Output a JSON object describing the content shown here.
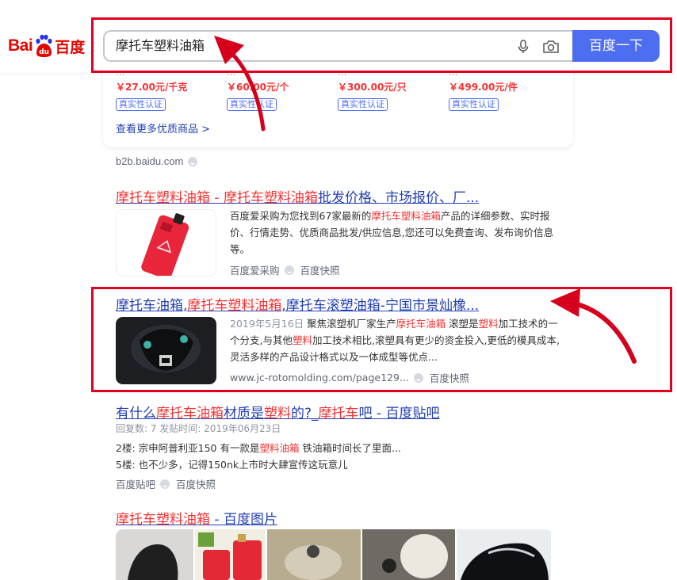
{
  "logo": {
    "latin": "Bai",
    "chinese": "百度"
  },
  "search": {
    "query": "摩托车塑料油箱",
    "button": "百度一下"
  },
  "products": [
    {
      "title": "...",
      "price": "￥27.00元/千克",
      "cert": "真实性认证"
    },
    {
      "title": "...",
      "price": "￥60.00元/个",
      "cert": "真实性认证"
    },
    {
      "title": "...",
      "price": "￥300.00元/只",
      "cert": "真实性认证"
    },
    {
      "title": "...",
      "price": "￥499.00元/件",
      "cert": "真实性认证"
    }
  ],
  "more_products": "查看更多优质商品 >",
  "source_domain": "b2b.baidu.com",
  "result1": {
    "title_a": "摩托车塑料油箱",
    "title_b": " - ",
    "title_c": "摩托车塑料油箱",
    "title_d": "批发价格、市场报价、厂...",
    "abstract_a": "百度爱采购为您找到67家最新的",
    "abstract_em": "摩托车塑料油箱",
    "abstract_b": "产品的详细参数、实时报价、行情走势、优质商品批发/供应信息,您还可以免费查询、发布询价信息等。",
    "source": "百度爱采购",
    "snapshot": "百度快照"
  },
  "result2": {
    "title_a": "摩托车油箱",
    "title_b": ",",
    "title_c": "摩托车塑料油箱",
    "title_d": ",摩托车滚塑油箱-宁国市景灿橡...",
    "date": "2019年5月16日",
    "abstract_a": " 聚焦滚塑机厂家生产",
    "abstract_em1": "摩托车油箱",
    "abstract_b": " 滚塑是",
    "abstract_em2": "塑料",
    "abstract_c": "加工技术的一个分支,与其他",
    "abstract_em3": "塑料",
    "abstract_d": "加工技术相比,滚塑具有更少的资金投入,更低的模具成本,灵活多样的产品设计格式以及一体成型等优点...",
    "url": "www.jc-rotomolding.com/page129...",
    "snapshot": "百度快照"
  },
  "result3": {
    "title_a": "有什么",
    "title_b": "摩托车油箱",
    "title_c": "材质是",
    "title_d": "塑料",
    "title_e": "的?_",
    "title_f": "摩托车",
    "title_g": "吧 - 百度贴吧",
    "meta": "回复数: 7 发贴时间: 2019年06月23日",
    "line1_a": "2楼: 宗申阿普利亚150 有一款是",
    "line1_em": "塑料油箱",
    "line1_b": " 铁油箱时间长了里面...",
    "line2": "5楼: 也不少多，记得150nk上市时大肆宣传这玩意儿",
    "source": "百度贴吧",
    "snapshot": "百度快照"
  },
  "result4": {
    "title_a": "摩托车塑料油箱",
    "title_b": " - 百度图片"
  },
  "colors": {
    "brand_red": "#e10601",
    "link_blue": "#2440b3",
    "highlight_red": "#f73131",
    "button_blue": "#4e6ef2",
    "annotation_red": "#e1001e"
  }
}
